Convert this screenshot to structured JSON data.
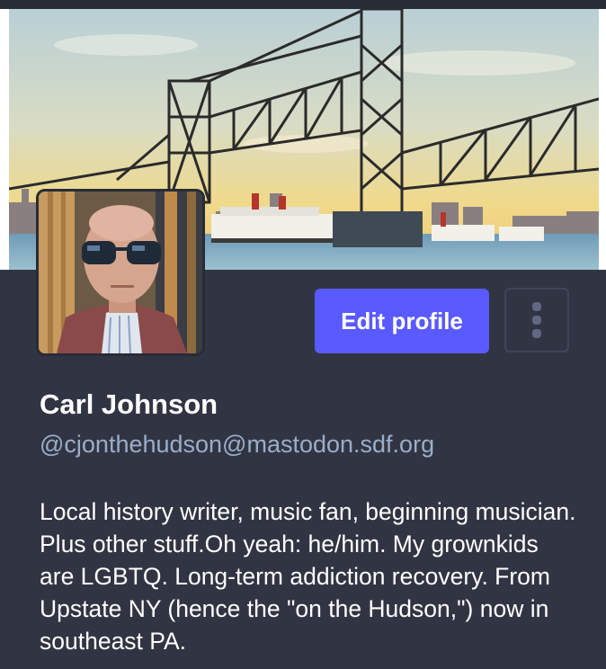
{
  "profile": {
    "display_name": "Carl Johnson",
    "account": "@cjonthehudson@mastodon.sdf.org",
    "bio": "Local history writer, music fan, beginning musician. Plus other stuff.Oh yeah: he/him. My grownkids are LGBTQ. Long-term addiction recovery. From Upstate NY (hence the \"on the Hudson,\") now in southeast PA."
  },
  "actions": {
    "edit_profile_label": "Edit profile",
    "more_icon": "vertical-ellipsis-icon"
  },
  "images": {
    "header": "postcard illustration of a steel lift bridge over a river with steamboats",
    "avatar": "selfie photo of a man wearing sunglasses"
  },
  "colors": {
    "background": "#282c37",
    "card": "#313543",
    "accent": "#595aff",
    "secondary_text": "#9baec8"
  }
}
